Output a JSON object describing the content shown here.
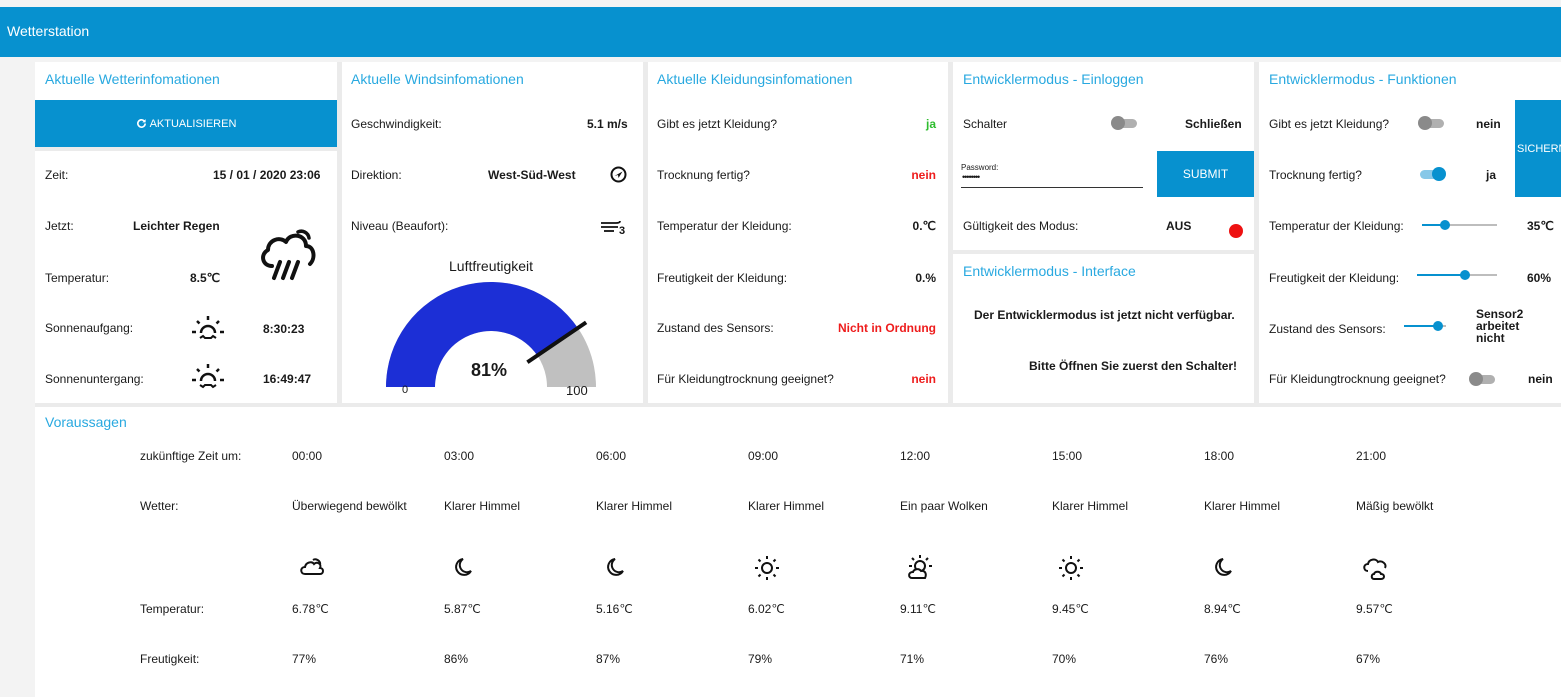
{
  "app": {
    "title": "Wetterstation"
  },
  "colors": {
    "accent": "#0791cf",
    "title": "#29a9e0",
    "ok": "#2ebd2e",
    "bad": "#ee1c1c",
    "gauge_fill": "#1c2fd6",
    "gauge_rest": "#c0c0c0"
  },
  "weather": {
    "title": "Aktuelle Wetterinfomationen",
    "refresh_label": "AKTUALISIEREN",
    "refresh_icon": "refresh-icon",
    "time_label": "Zeit:",
    "time_value": "15 / 01 / 2020 23:06",
    "now_label": "Jetzt:",
    "now_value": "Leichter Regen",
    "now_icon": "rain-cloud-icon",
    "temp_label": "Temperatur:",
    "temp_value": "8.5℃",
    "sunrise_label": "Sonnenaufgang:",
    "sunrise_value": "8:30:23",
    "sunrise_icon": "sunrise-icon",
    "sunset_label": "Sonnenuntergang:",
    "sunset_value": "16:49:47",
    "sunset_icon": "sunset-icon"
  },
  "wind": {
    "title": "Aktuelle Windsinfomationen",
    "speed_label": "Geschwindigkeit:",
    "speed_value": "5.1 m/s",
    "dir_label": "Direktion:",
    "dir_value": "West-Süd-West",
    "dir_icon": "compass-icon",
    "level_label": "Niveau (Beaufort):",
    "level_icon": "beaufort-3-icon",
    "gauge": {
      "title": "Luftfreutigkeit",
      "value": 81,
      "value_label": "81%",
      "min_label": "0",
      "max_label": "100"
    }
  },
  "clothes": {
    "title": "Aktuelle Kleidungsinfomationen",
    "rows": [
      {
        "label": "Gibt es jetzt Kleidung?",
        "value": "ja",
        "color": "#2ebd2e"
      },
      {
        "label": "Trocknung fertig?",
        "value": "nein",
        "color": "#ee1c1c"
      },
      {
        "label": "Temperatur der Kleidung:",
        "value": "0.℃",
        "color": "#1a1a1a"
      },
      {
        "label": "Freutigkeit der Kleidung:",
        "value": "0.%",
        "color": "#1a1a1a"
      },
      {
        "label": "Zustand des Sensors:",
        "value": "Nicht in Ordnung",
        "color": "#ee1c1c"
      },
      {
        "label": "Für Kleidungtrocknung geeignet?",
        "value": "nein",
        "color": "#ee1c1c"
      }
    ]
  },
  "login": {
    "title": "Entwicklermodus - Einloggen",
    "switch_label": "Schalter",
    "switch_on": false,
    "switch_value": "Schließen",
    "password_label": "Password:",
    "password_value": "••••••••",
    "submit_label": "SUBMIT",
    "validity_label": "Gültigkeit des Modus:",
    "validity_value": "AUS",
    "validity_color": "#ee1111"
  },
  "interface": {
    "title": "Entwicklermodus - Interface",
    "msg1": "Der Entwicklermodus ist jetzt nicht verfügbar.",
    "msg2": "Bitte Öffnen Sie zuerst den Schalter!"
  },
  "functions": {
    "title": "Entwicklermodus - Funktionen",
    "save_label": "SICHERN",
    "r1_label": "Gibt es jetzt Kleidung?",
    "r1_on": false,
    "r1_value": "nein",
    "r2_label": "Trocknung fertig?",
    "r2_on": true,
    "r2_value": "ja",
    "r3_label": "Temperatur der Kleidung:",
    "r3_level": 0.3,
    "r3_value": "35℃",
    "r4_label": "Freutigkeit der Kleidung:",
    "r4_level": 0.6,
    "r4_value": "60%",
    "r5_label": "Zustand des Sensors:",
    "r5_level": 0.8,
    "r5_value_lines": [
      "Sensor2",
      "arbeitet",
      "nicht"
    ],
    "r6_label": "Für Kleidungtrocknung geeignet?",
    "r6_on": false,
    "r6_value": "nein"
  },
  "forecast": {
    "title": "Voraussagen",
    "time_label": "zukünftige Zeit um:",
    "weather_label": "Wetter:",
    "temp_label": "Temperatur:",
    "humidity_label": "Freutigkeit:",
    "columns": [
      {
        "time": "00:00",
        "weather": "Überwiegend bewölkt",
        "icon": "cloud-moon-icon",
        "temp": "6.78℃",
        "humidity": "77%"
      },
      {
        "time": "03:00",
        "weather": "Klarer Himmel",
        "icon": "moon-icon",
        "temp": "5.87℃",
        "humidity": "86%"
      },
      {
        "time": "06:00",
        "weather": "Klarer Himmel",
        "icon": "moon-icon",
        "temp": "5.16℃",
        "humidity": "87%"
      },
      {
        "time": "09:00",
        "weather": "Klarer Himmel",
        "icon": "sun-icon",
        "temp": "6.02℃",
        "humidity": "79%"
      },
      {
        "time": "12:00",
        "weather": "Ein paar Wolken",
        "icon": "sun-cloud-icon",
        "temp": "9.11℃",
        "humidity": "71%"
      },
      {
        "time": "15:00",
        "weather": "Klarer Himmel",
        "icon": "sun-icon",
        "temp": "9.45℃",
        "humidity": "70%"
      },
      {
        "time": "18:00",
        "weather": "Klarer Himmel",
        "icon": "moon-icon",
        "temp": "8.94℃",
        "humidity": "76%"
      },
      {
        "time": "21:00",
        "weather": "Mäßig bewölkt",
        "icon": "clouds-icon",
        "temp": "9.57℃",
        "humidity": "67%"
      }
    ]
  }
}
